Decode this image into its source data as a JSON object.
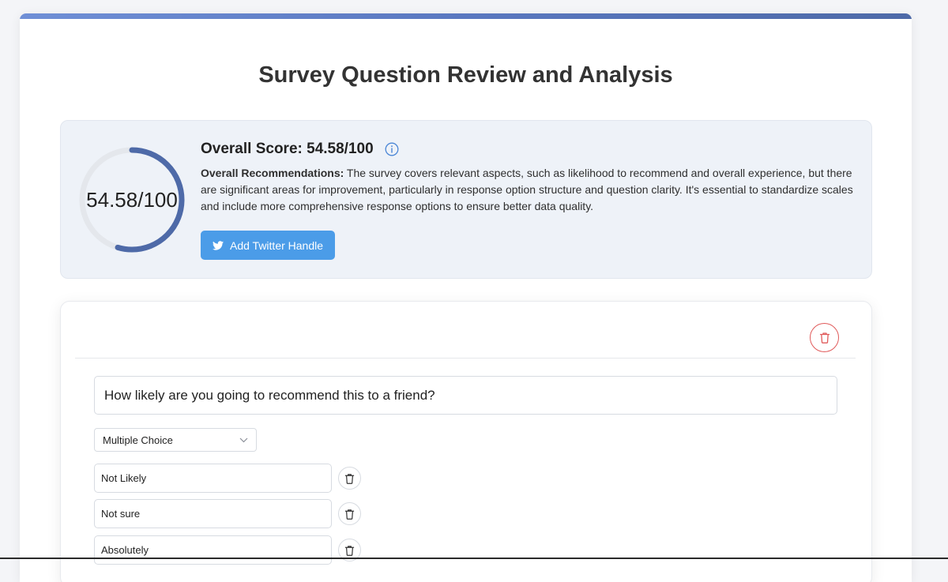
{
  "header": {
    "title": "Survey Question Review and Analysis"
  },
  "score": {
    "value": 54.58,
    "max": 100,
    "ring_label": "54.58/100",
    "heading": "Overall Score: 54.58/100",
    "ring_color": "#4e6aa8",
    "track_color": "#e4e7ec",
    "info_icon": "info-icon"
  },
  "recommendations": {
    "label": "Overall Recommendations:",
    "text": " The survey covers relevant aspects, such as likelihood to recommend and overall experience, but there are significant areas for improvement, particularly in response option structure and question clarity. It's essential to standardize scales and include more comprehensive response options to ensure better data quality."
  },
  "twitter_button": {
    "label": "Add Twitter Handle",
    "icon": "twitter-icon",
    "color": "#4b9ce8"
  },
  "question": {
    "text": "How likely are you going to recommend this to a friend?",
    "type": "Multiple Choice",
    "delete_icon": "trash-icon",
    "options": [
      {
        "value": "Not Likely"
      },
      {
        "value": "Not sure"
      },
      {
        "value": "Absolutely"
      }
    ]
  }
}
